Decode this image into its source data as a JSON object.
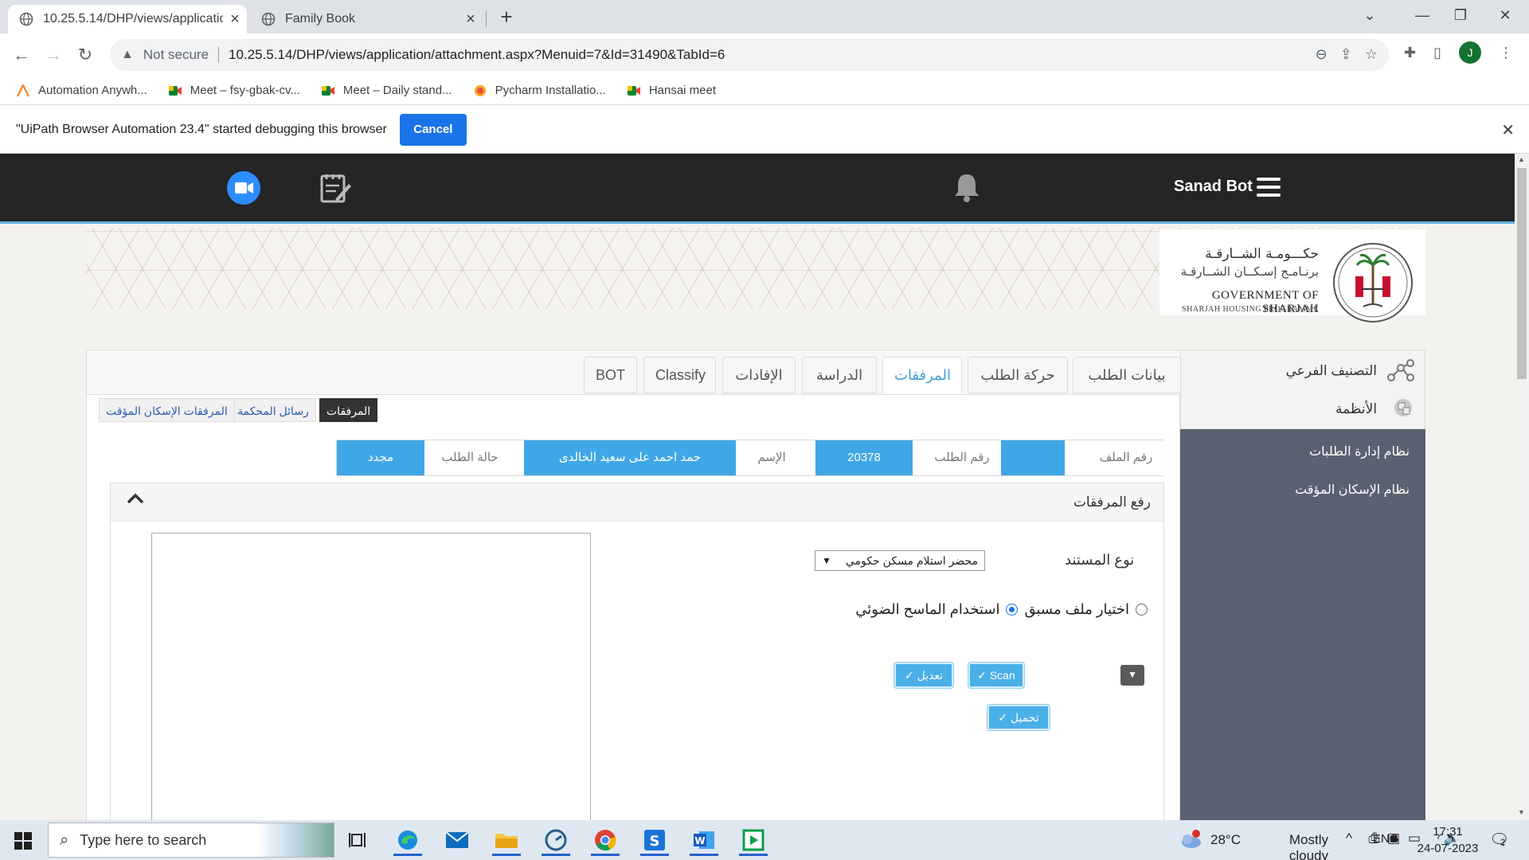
{
  "browser": {
    "tabs": [
      {
        "title": "10.25.5.14/DHP/views/applicatio",
        "active": true
      },
      {
        "title": "Family Book",
        "active": false
      }
    ],
    "new_tab": "+",
    "window_controls": {
      "minimize": "—",
      "restore": "❐",
      "close": "✕",
      "dropdown": "⌄"
    },
    "security_label": "Not secure",
    "url": "10.25.5.14/DHP/views/application/attachment.aspx?Menuid=7&Id=31490&TabId=6",
    "profile_initial": "J",
    "bookmarks": [
      {
        "label": "Automation Anywh...",
        "icon": "automation-anywhere-icon",
        "color": "#f28b30"
      },
      {
        "label": "Meet – fsy-gbak-cv...",
        "icon": "google-meet-icon",
        "color": "#00832d"
      },
      {
        "label": "Meet – Daily stand...",
        "icon": "google-meet-icon",
        "color": "#00832d"
      },
      {
        "label": "Pycharm Installatio...",
        "icon": "pycharm-icon",
        "color": "#f5a623"
      },
      {
        "label": "Hansai meet",
        "icon": "google-meet-icon",
        "color": "#00832d"
      }
    ],
    "infobar": {
      "message": "\"UiPath Browser Automation 23.4\" started debugging this browser",
      "cancel_label": "Cancel"
    }
  },
  "app": {
    "header": {
      "user_name": "Sanad Bot",
      "accent_color": "#5fb1d9"
    },
    "logo": {
      "arabic_line1": "حكـــومـة الشــارقـة",
      "arabic_line2": "برنـامـج إسـكــان الشــارقـة",
      "english_line1": "GOVERNMENT OF SHARJAH",
      "english_line2": "SHARJAH HOUSING PROGRAMME"
    },
    "main_tabs": [
      {
        "label": "بيانات الطلب",
        "active": false
      },
      {
        "label": "حركة الطلب",
        "active": false
      },
      {
        "label": "المرفقات",
        "active": true
      },
      {
        "label": "الدراسة",
        "active": false
      },
      {
        "label": "الإفادات",
        "active": false
      },
      {
        "label": "Classify",
        "active": false
      },
      {
        "label": "BOT",
        "active": false
      }
    ],
    "sub_tabs": [
      {
        "label": "المرفقات",
        "active": true
      },
      {
        "label": "رسائل المحكمة",
        "active": false
      },
      {
        "label": "المرفقات الإسكان المؤقت",
        "active": false
      }
    ],
    "info_strip": {
      "file_no_label": "رقم الملف",
      "file_no_value": "",
      "request_no_label": "رقم الطلب",
      "request_no_value": "20378",
      "name_label": "الإسم",
      "name_value": "حمد احمد على سعيد الخالدى",
      "status_label": "حالة الطلب",
      "status_value": "مجدد"
    },
    "upload_panel": {
      "title": "رفع المرفقات",
      "doc_type_label": "نوع المستند",
      "doc_type_selected": "محضر استلام مسكن حكومي",
      "radio_existing": "اختيار ملف مسبق",
      "radio_scanner": "استخدام الماسح الضوئي",
      "scan_label": "Scan",
      "edit_label": "تعديل",
      "upload_label": "تحميل"
    },
    "sidebar": {
      "sub_category": "التصنيف الفرعي",
      "systems": "الأنظمة",
      "links": [
        "نظام إدارة الطلبات",
        "نظام الإسكان المؤقت"
      ]
    }
  },
  "taskbar": {
    "search_placeholder": "Type here to search",
    "weather_temp": "28°C",
    "weather_text": "Mostly cloudy",
    "weather_badge": "1",
    "language": "ENG",
    "time": "17:31",
    "date": "24-07-2023",
    "notification_count": "2"
  }
}
